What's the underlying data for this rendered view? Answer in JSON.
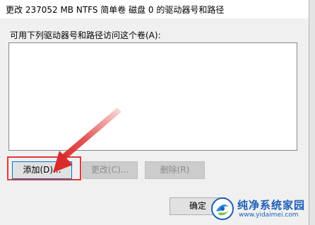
{
  "dialog": {
    "title": "更改 237052 MB NTFS 简单卷 磁盘 0 的驱动器号和路径",
    "section_label": "可用下列驱动器号和路径访问这个卷(A):",
    "list_items": []
  },
  "buttons": {
    "add": "添加(D)...",
    "change": "更改(C)...",
    "delete": "删除(R)",
    "ok": "确定"
  },
  "annotation": {
    "color": "#e0393a"
  },
  "watermark": {
    "name": "纯净系统家园",
    "url": "www.yidaimei.com",
    "color": "#1e5fb8"
  }
}
